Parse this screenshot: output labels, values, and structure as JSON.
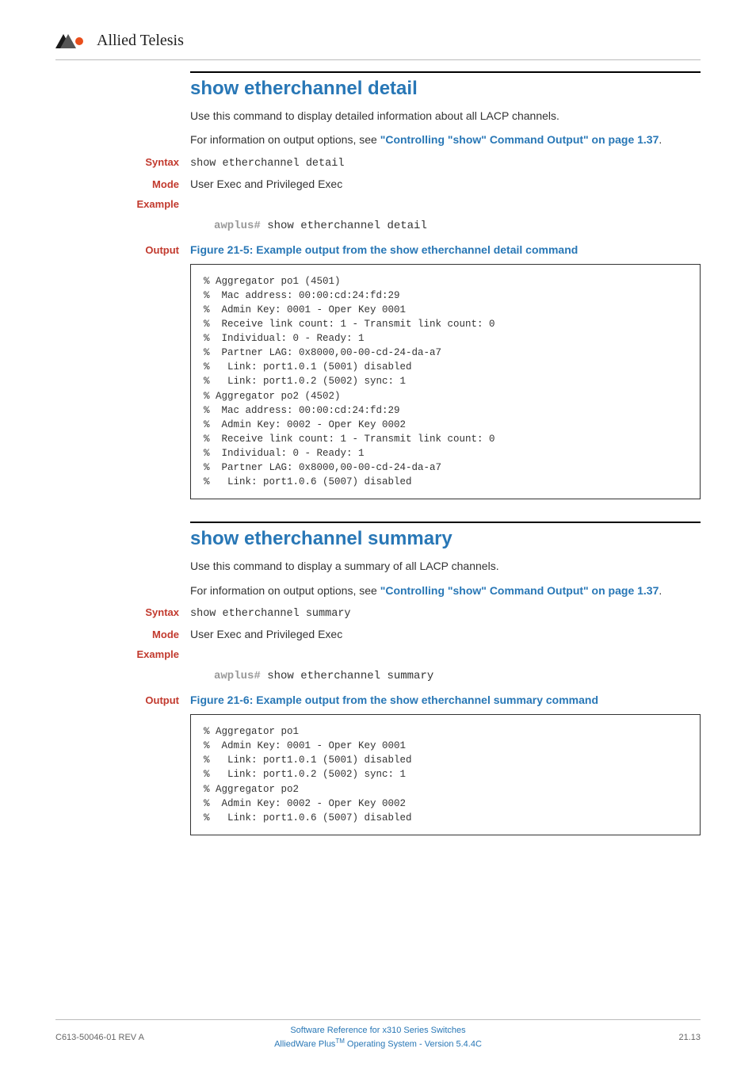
{
  "header": {
    "brand": "Allied Telesis"
  },
  "section1": {
    "title": "show etherchannel detail",
    "desc": "Use this command to display detailed information about all LACP channels.",
    "info_prefix": "For information on output options, see ",
    "info_link": "\"Controlling \"show\" Command Output\" on page 1.37",
    "info_suffix": ".",
    "syntax_label": "Syntax",
    "syntax_value": "show etherchannel detail",
    "mode_label": "Mode",
    "mode_value": "User Exec and Privileged Exec",
    "example_label": "Example",
    "example_prompt": "awplus#",
    "example_cmd": " show etherchannel detail",
    "output_label": "Output",
    "figure_title": "Figure 21-5: Example output from the show etherchannel detail command",
    "output_box": "% Aggregator po1 (4501)\n%  Mac address: 00:00:cd:24:fd:29\n%  Admin Key: 0001 - Oper Key 0001\n%  Receive link count: 1 - Transmit link count: 0\n%  Individual: 0 - Ready: 1\n%  Partner LAG: 0x8000,00-00-cd-24-da-a7\n%   Link: port1.0.1 (5001) disabled\n%   Link: port1.0.2 (5002) sync: 1\n% Aggregator po2 (4502)\n%  Mac address: 00:00:cd:24:fd:29\n%  Admin Key: 0002 - Oper Key 0002\n%  Receive link count: 1 - Transmit link count: 0\n%  Individual: 0 - Ready: 1\n%  Partner LAG: 0x8000,00-00-cd-24-da-a7\n%   Link: port1.0.6 (5007) disabled"
  },
  "section2": {
    "title": "show etherchannel summary",
    "desc": "Use this command to display a summary of all LACP channels.",
    "info_prefix": "For information on output options, see ",
    "info_link": "\"Controlling \"show\" Command Output\" on page 1.37",
    "info_suffix": ".",
    "syntax_label": "Syntax",
    "syntax_value": "show etherchannel summary",
    "mode_label": "Mode",
    "mode_value": "User Exec and Privileged Exec",
    "example_label": "Example",
    "example_prompt": "awplus#",
    "example_cmd": " show etherchannel summary",
    "output_label": "Output",
    "figure_title": "Figure 21-6: Example output from the show etherchannel summary command",
    "output_box": "% Aggregator po1\n%  Admin Key: 0001 - Oper Key 0001\n%   Link: port1.0.1 (5001) disabled\n%   Link: port1.0.2 (5002) sync: 1\n% Aggregator po2\n%  Admin Key: 0002 - Oper Key 0002\n%   Link: port1.0.6 (5007) disabled"
  },
  "footer": {
    "left": "C613-50046-01 REV A",
    "center_line1": "Software Reference for x310 Series Switches",
    "center_line2_prefix": "AlliedWare Plus",
    "center_line2_tm": "TM",
    "center_line2_suffix": " Operating System - Version 5.4.4C",
    "right": "21.13"
  }
}
